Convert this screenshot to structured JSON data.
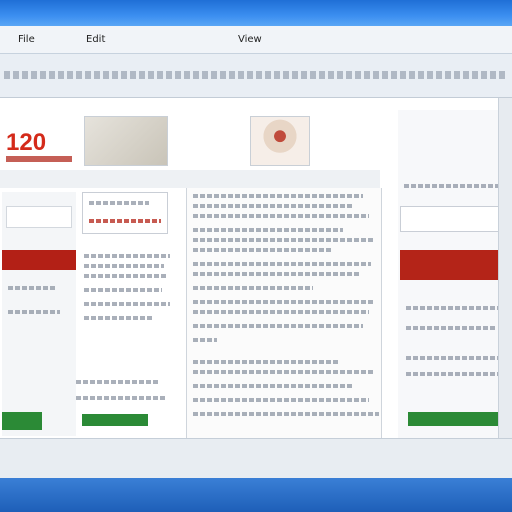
{
  "browser": {
    "menu": [
      "File",
      "Edit",
      "View"
    ],
    "title_label": "",
    "address_value": ""
  },
  "page": {
    "logo_text": "120",
    "nav_text": "",
    "left_blocks": [
      ""
    ],
    "headlines": [
      "",
      "",
      ""
    ]
  },
  "colors": {
    "brand_red": "#d42a1a",
    "accent_green": "#2b8a36",
    "title_blue": "#1f6fd6"
  },
  "icons": [
    "logo-icon",
    "photo-icon",
    "scrollbar-icon"
  ]
}
